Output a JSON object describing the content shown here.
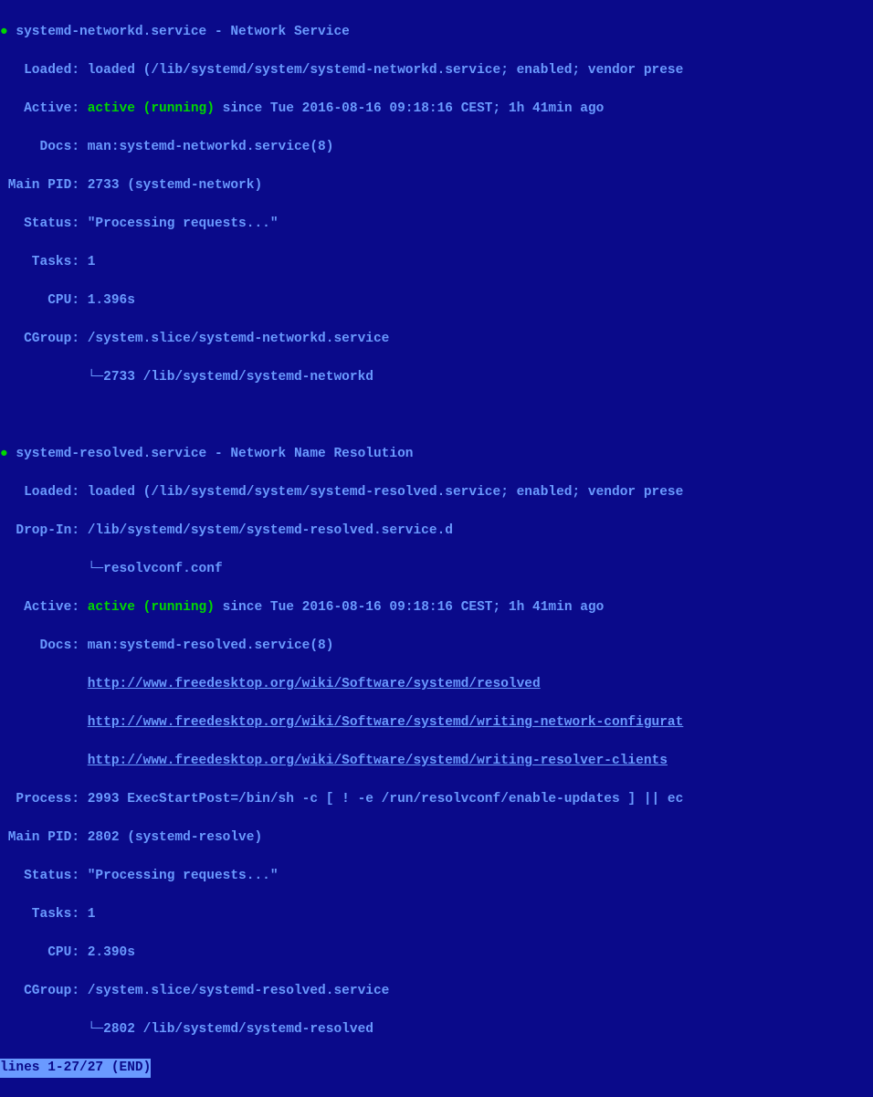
{
  "svc1": {
    "header": "systemd-networkd.service - Network Service",
    "loaded": "   Loaded: loaded (/lib/systemd/system/systemd-networkd.service; enabled; vendor prese",
    "active_label": "   Active: ",
    "active_state": "active (running)",
    "active_rest": " since Tue 2016-08-16 09:18:16 CEST; 1h 41min ago",
    "docs": "     Docs: man:systemd-networkd.service(8)",
    "mainpid": " Main PID: 2733 (systemd-network)",
    "status": "   Status: \"Processing requests...\"",
    "tasks": "    Tasks: 1",
    "cpu": "      CPU: 1.396s",
    "cgroup": "   CGroup: /system.slice/systemd-networkd.service",
    "cgroup_child": "           └─2733 /lib/systemd/systemd-networkd"
  },
  "svc2": {
    "header": "systemd-resolved.service - Network Name Resolution",
    "loaded": "   Loaded: loaded (/lib/systemd/system/systemd-resolved.service; enabled; vendor prese",
    "dropin": "  Drop-In: /lib/systemd/system/systemd-resolved.service.d",
    "dropin_child": "           └─resolvconf.conf",
    "active_label": "   Active: ",
    "active_state": "active (running)",
    "active_rest": " since Tue 2016-08-16 09:18:16 CEST; 1h 41min ago",
    "docs": "     Docs: man:systemd-resolved.service(8)",
    "doc_link1": "http://www.freedesktop.org/wiki/Software/systemd/resolved",
    "doc_link2": "http://www.freedesktop.org/wiki/Software/systemd/writing-network-configurat",
    "doc_link3": "http://www.freedesktop.org/wiki/Software/systemd/writing-resolver-clients",
    "process": "  Process: 2993 ExecStartPost=/bin/sh -c [ ! -e /run/resolvconf/enable-updates ] || ec",
    "mainpid": " Main PID: 2802 (systemd-resolve)",
    "status": "   Status: \"Processing requests...\"",
    "tasks": "    Tasks: 1",
    "cpu": "      CPU: 2.390s",
    "cgroup": "   CGroup: /system.slice/systemd-resolved.service",
    "cgroup_child": "           └─2802 /lib/systemd/systemd-resolved"
  },
  "pager": "lines 1-27/27 (END)",
  "indent11": "           ",
  "dot_prefix": "● "
}
